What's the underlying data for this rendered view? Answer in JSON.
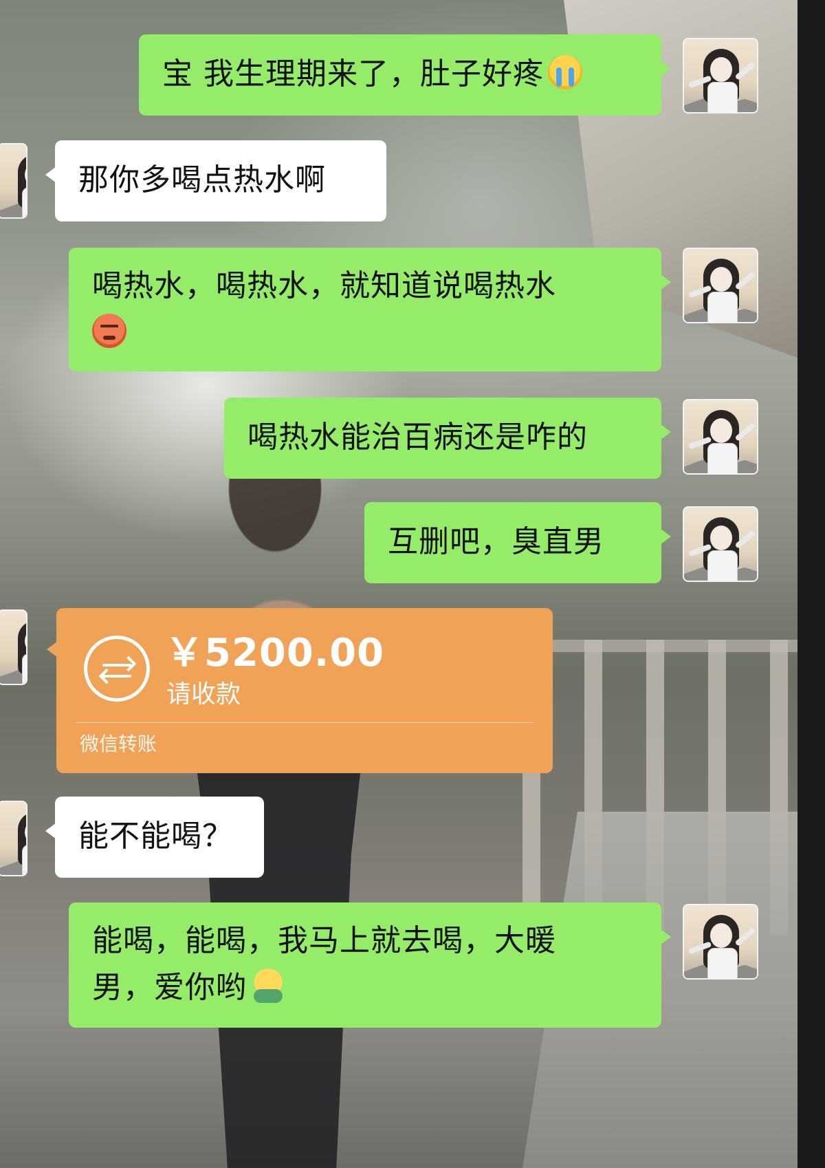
{
  "messages": [
    {
      "side": "me",
      "text": "宝 我生理期来了，肚子好疼",
      "emoji": "crying-face"
    },
    {
      "side": "other",
      "text": "那你多喝点热水啊"
    },
    {
      "side": "me",
      "text": "喝热水，喝热水，就知道说喝热水",
      "emoji": "angry-face"
    },
    {
      "side": "me",
      "text": "喝热水能治百病还是咋的"
    },
    {
      "side": "me",
      "text": "互删吧，臭直男"
    },
    {
      "side": "other",
      "type": "transfer",
      "amount": "￥5200.00",
      "status": "请收款",
      "footer": "微信转账"
    },
    {
      "side": "other",
      "text": "能不能喝？"
    },
    {
      "side": "me",
      "text_line1": "能喝，能喝，我马上就去喝，大暖",
      "text_line2": "男，爱你哟",
      "emoji": "hug-face"
    }
  ],
  "colors": {
    "my_bubble": "#95ec69",
    "other_bubble": "#ffffff",
    "transfer_card": "#f0a256"
  }
}
